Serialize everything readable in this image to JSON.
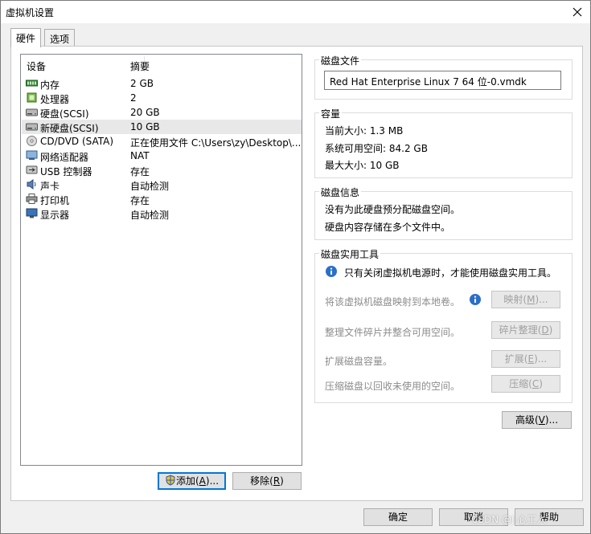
{
  "window": {
    "title": "虚拟机设置"
  },
  "tabs": [
    {
      "label": "硬件"
    },
    {
      "label": "选项"
    }
  ],
  "device_list": {
    "headers": {
      "device": "设备",
      "summary": "摘要"
    },
    "rows": [
      {
        "name": "内存",
        "summary": "2 GB",
        "icon": "memory-icon"
      },
      {
        "name": "处理器",
        "summary": "2",
        "icon": "processor-icon"
      },
      {
        "name": "硬盘(SCSI)",
        "summary": "20 GB",
        "icon": "harddisk-icon"
      },
      {
        "name": "新硬盘(SCSI)",
        "summary": "10 GB",
        "icon": "harddisk-icon",
        "selected": true
      },
      {
        "name": "CD/DVD (SATA)",
        "summary": "正在使用文件 C:\\Users\\zy\\Desktop\\...",
        "icon": "cdrom-icon"
      },
      {
        "name": "网络适配器",
        "summary": "NAT",
        "icon": "network-adapter-icon"
      },
      {
        "name": "USB 控制器",
        "summary": "存在",
        "icon": "usb-icon"
      },
      {
        "name": "声卡",
        "summary": "自动检测",
        "icon": "sound-card-icon"
      },
      {
        "name": "打印机",
        "summary": "存在",
        "icon": "printer-icon"
      },
      {
        "name": "显示器",
        "summary": "自动检测",
        "icon": "display-icon"
      }
    ]
  },
  "list_buttons": {
    "add": {
      "label": "添加",
      "mnemonic": "A",
      "suffix": "..."
    },
    "remove": {
      "label": "移除",
      "mnemonic": "R",
      "suffix": ""
    }
  },
  "disk_file": {
    "group_title": "磁盘文件",
    "value": "Red Hat Enterprise Linux 7 64 位-0.vmdk"
  },
  "capacity": {
    "group_title": "容量",
    "current_size": "当前大小: 1.3 MB",
    "system_free": "系统可用空间: 84.2 GB",
    "max_size": "最大大小: 10 GB"
  },
  "disk_info": {
    "group_title": "磁盘信息",
    "line1": "没有为此硬盘预分配磁盘空间。",
    "line2": "硬盘内容存储在多个文件中。"
  },
  "disk_utilities": {
    "group_title": "磁盘实用工具",
    "notice": "只有关闭虚拟机电源时，才能使用磁盘实用工具。",
    "map_text": "将该虚拟机磁盘映射到本地卷。",
    "defrag_text": "整理文件碎片并整合可用空间。",
    "expand_text": "扩展磁盘容量。",
    "compact_text": "压缩磁盘以回收未使用的空间。",
    "map_button": {
      "label": "映射",
      "mnemonic": "M",
      "suffix": "..."
    },
    "defrag_button": {
      "label": "碎片整理",
      "mnemonic": "D",
      "suffix": ""
    },
    "expand_button": {
      "label": "扩展",
      "mnemonic": "E",
      "suffix": "..."
    },
    "compact_button": {
      "label": "压缩",
      "mnemonic": "C",
      "suffix": ""
    }
  },
  "advanced_button": {
    "label": "高级",
    "mnemonic": "V",
    "suffix": "..."
  },
  "footer": {
    "ok": "确定",
    "cancel": "取消",
    "help": "帮助",
    "watermark": "CSDN @J  心工人"
  }
}
